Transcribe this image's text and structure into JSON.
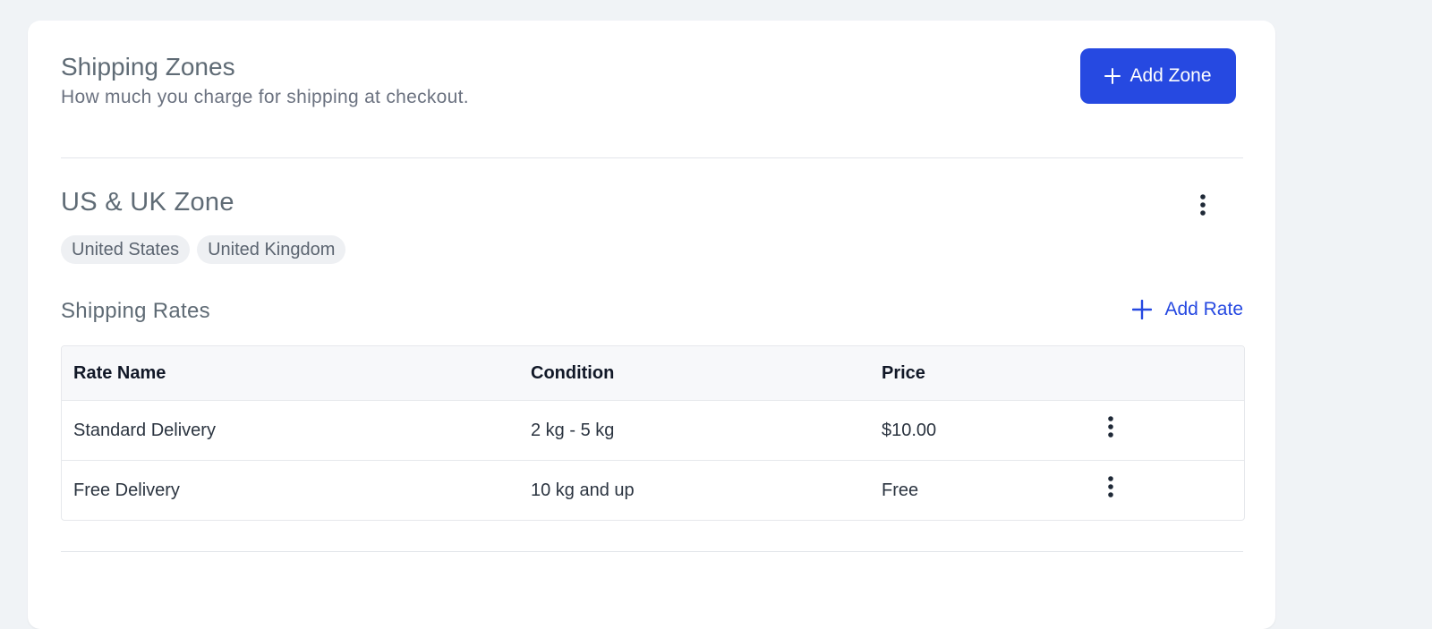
{
  "header": {
    "title": "Shipping Zones",
    "subtitle": "How much you charge for shipping at checkout.",
    "add_zone_label": "Add Zone"
  },
  "zone": {
    "name": "US & UK Zone",
    "countries": [
      "United States",
      "United Kingdom"
    ]
  },
  "rates": {
    "title": "Shipping Rates",
    "add_rate_label": "Add Rate",
    "columns": [
      "Rate Name",
      "Condition",
      "Price"
    ],
    "rows": [
      {
        "name": "Standard Delivery",
        "condition": "2 kg - 5 kg",
        "price": "$10.00"
      },
      {
        "name": "Free Delivery",
        "condition": "10 kg and up",
        "price": "Free"
      }
    ]
  },
  "colors": {
    "accent": "#2649e1",
    "background": "#f0f3f6",
    "card": "#ffffff"
  }
}
